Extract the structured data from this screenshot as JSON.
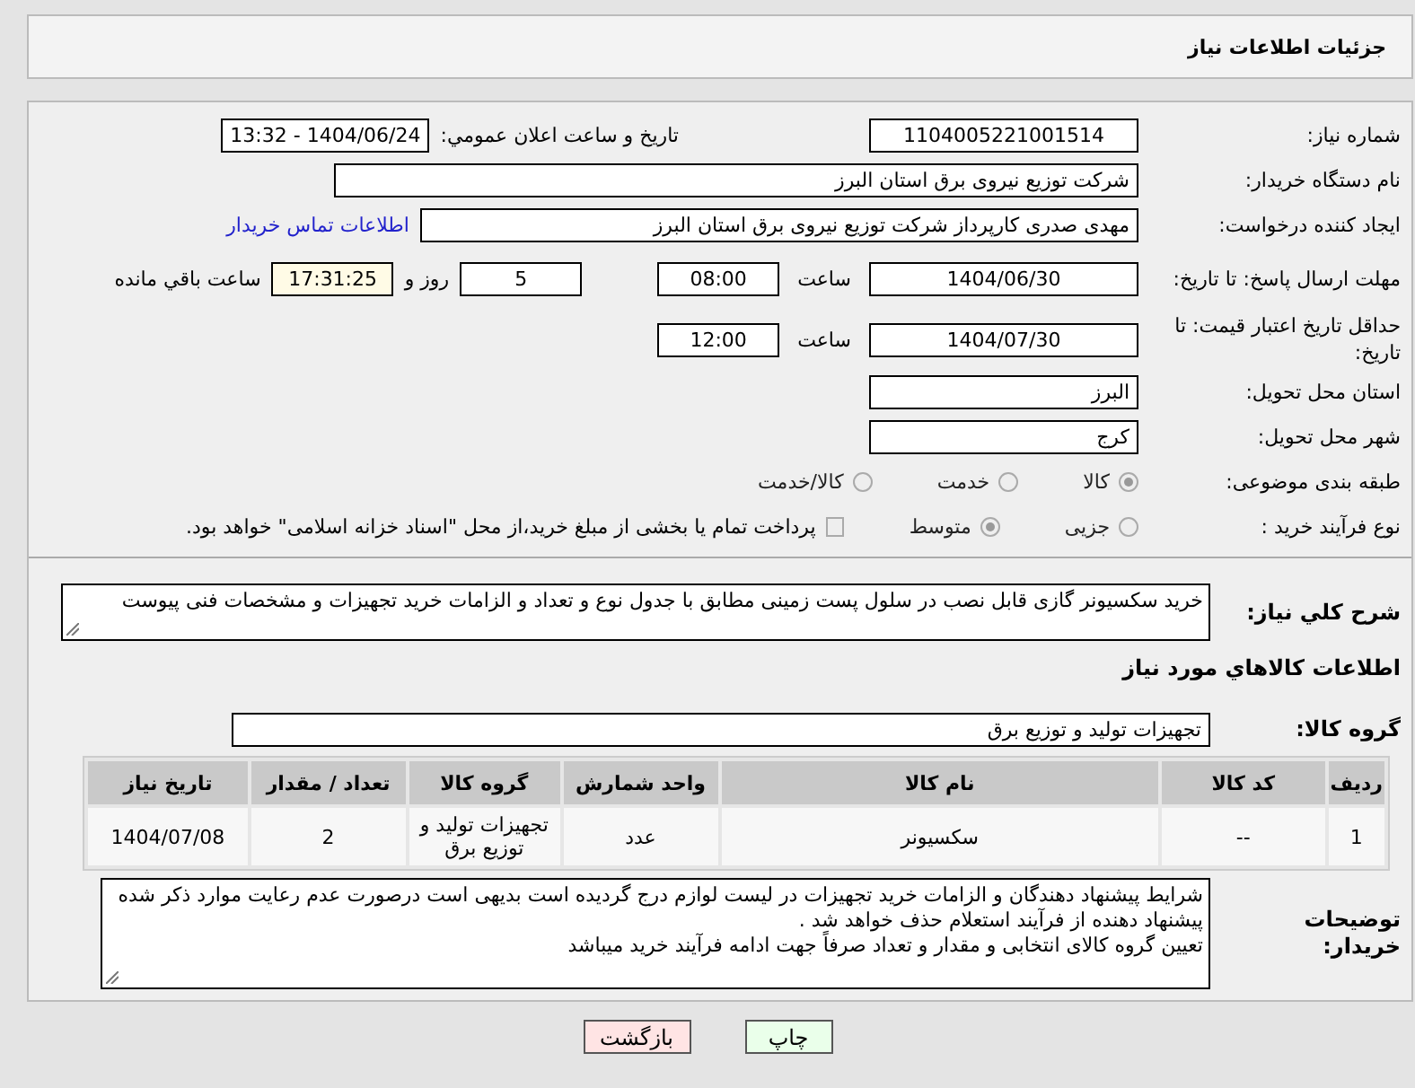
{
  "header": {
    "title": "جزئیات اطلاعات نیاز"
  },
  "form": {
    "need_number": {
      "label": "شماره نیاز:",
      "value": "1104005221001514"
    },
    "announce": {
      "label": "تاریخ و ساعت اعلان عمومي:",
      "value": "1404/06/24 - 13:32"
    },
    "buyer": {
      "label": "نام دستگاه خریدار:",
      "value": "شرکت توزیع نیروی برق استان البرز"
    },
    "creator": {
      "label": "ایجاد کننده درخواست:",
      "value": "مهدی صدری کارپرداز شرکت توزیع نیروی برق استان البرز",
      "link": "اطلاعات تماس خریدار"
    },
    "deadline": {
      "label": "مهلت ارسال پاسخ: تا تاریخ:",
      "date": "1404/06/30",
      "time_label": "ساعت",
      "time": "08:00",
      "days": "5",
      "days_label": "روز و",
      "remaining": "17:31:25",
      "remaining_label": "ساعت باقي مانده"
    },
    "validity": {
      "label": "حداقل تاریخ اعتبار قیمت: تا تاریخ:",
      "date": "1404/07/30",
      "time_label": "ساعت",
      "time": "12:00"
    },
    "province": {
      "label": "استان محل تحویل:",
      "value": "البرز"
    },
    "city": {
      "label": "شهر محل تحویل:",
      "value": "کرج"
    },
    "category": {
      "label": "طبقه بندی موضوعی:",
      "options": [
        {
          "label": "کالا",
          "selected": true
        },
        {
          "label": "خدمت",
          "selected": false
        },
        {
          "label": "کالا/خدمت",
          "selected": false
        }
      ]
    },
    "process": {
      "label": "نوع فرآیند خرید :",
      "options": [
        {
          "label": "جزیی",
          "selected": false
        },
        {
          "label": "متوسط",
          "selected": true
        }
      ],
      "treasury": {
        "label": "پرداخت تمام یا بخشی از مبلغ خرید،از محل \"اسناد خزانه اسلامی\" خواهد بود.",
        "checked": false
      }
    }
  },
  "description": {
    "label": "شرح کلي نیاز:",
    "value": "خرید سکسیونر گازی قابل نصب در سلول پست زمینی مطابق با جدول نوع و تعداد و الزامات خرید تجهیزات و مشخصات فنی پیوست"
  },
  "goods": {
    "heading": "اطلاعات کالاهاي مورد نیاز",
    "group_label": "گروه کالا:",
    "group_value": "تجهیزات تولید و توزیع برق",
    "table": {
      "columns": [
        "ردیف",
        "کد کالا",
        "نام کالا",
        "واحد شمارش",
        "گروه کالا",
        "تعداد / مقدار",
        "تاریخ نیاز"
      ],
      "rows": [
        [
          "1",
          "--",
          "سکسیونر",
          "عدد",
          "تجهیزات تولید و توزیع برق",
          "2",
          "1404/07/08"
        ]
      ]
    }
  },
  "notes": {
    "label": "توضیحات خریدار:",
    "lines": [
      "شرایط پیشنهاد دهندگان و الزامات خرید تجهیزات در لیست لوازم درج گردیده است بدیهی است درصورت عدم رعایت موارد ذکر شده پیشنهاد دهنده از فرآیند استعلام حذف خواهد شد .",
      "تعیین گروه کالای انتخابی و مقدار و تعداد صرفاً جهت ادامه فرآیند خرید میباشد"
    ]
  },
  "buttons": [
    {
      "label": "چاپ",
      "kind": "print"
    },
    {
      "label": "بازگشت",
      "kind": "back"
    }
  ]
}
